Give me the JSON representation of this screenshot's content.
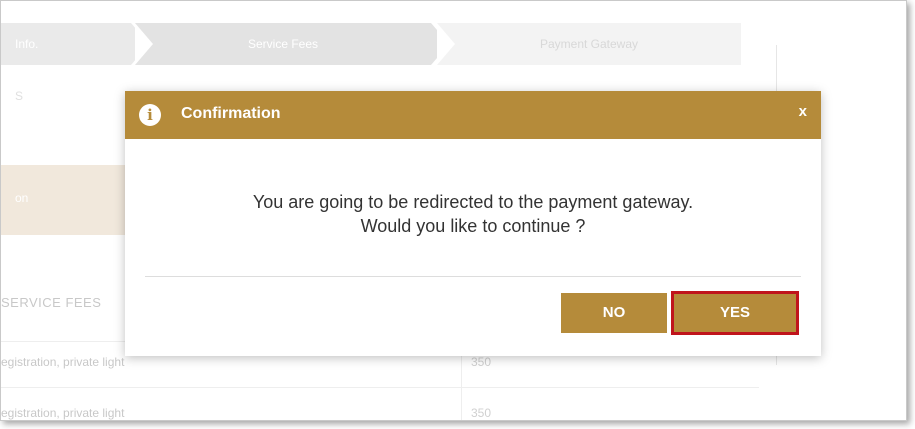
{
  "steps": [
    {
      "label": "Info."
    },
    {
      "label": "Service Fees"
    },
    {
      "label": "Payment Gateway"
    }
  ],
  "background": {
    "left_text": "S",
    "tan_label": "on",
    "section_label": "SERVICE FEES",
    "rows": [
      {
        "label": "egistration, private light",
        "value": "350"
      },
      {
        "label": "egistration, private light",
        "value": "350"
      }
    ]
  },
  "modal": {
    "title": "Confirmation",
    "info_glyph": "i",
    "close_label": "x",
    "message_line1": "You are going to be redirected to the payment gateway.",
    "message_line2": "Would you like to continue ?",
    "no_label": "NO",
    "yes_label": "YES"
  },
  "colors": {
    "accent": "#b58b3a",
    "highlight_border": "#c0141c"
  }
}
